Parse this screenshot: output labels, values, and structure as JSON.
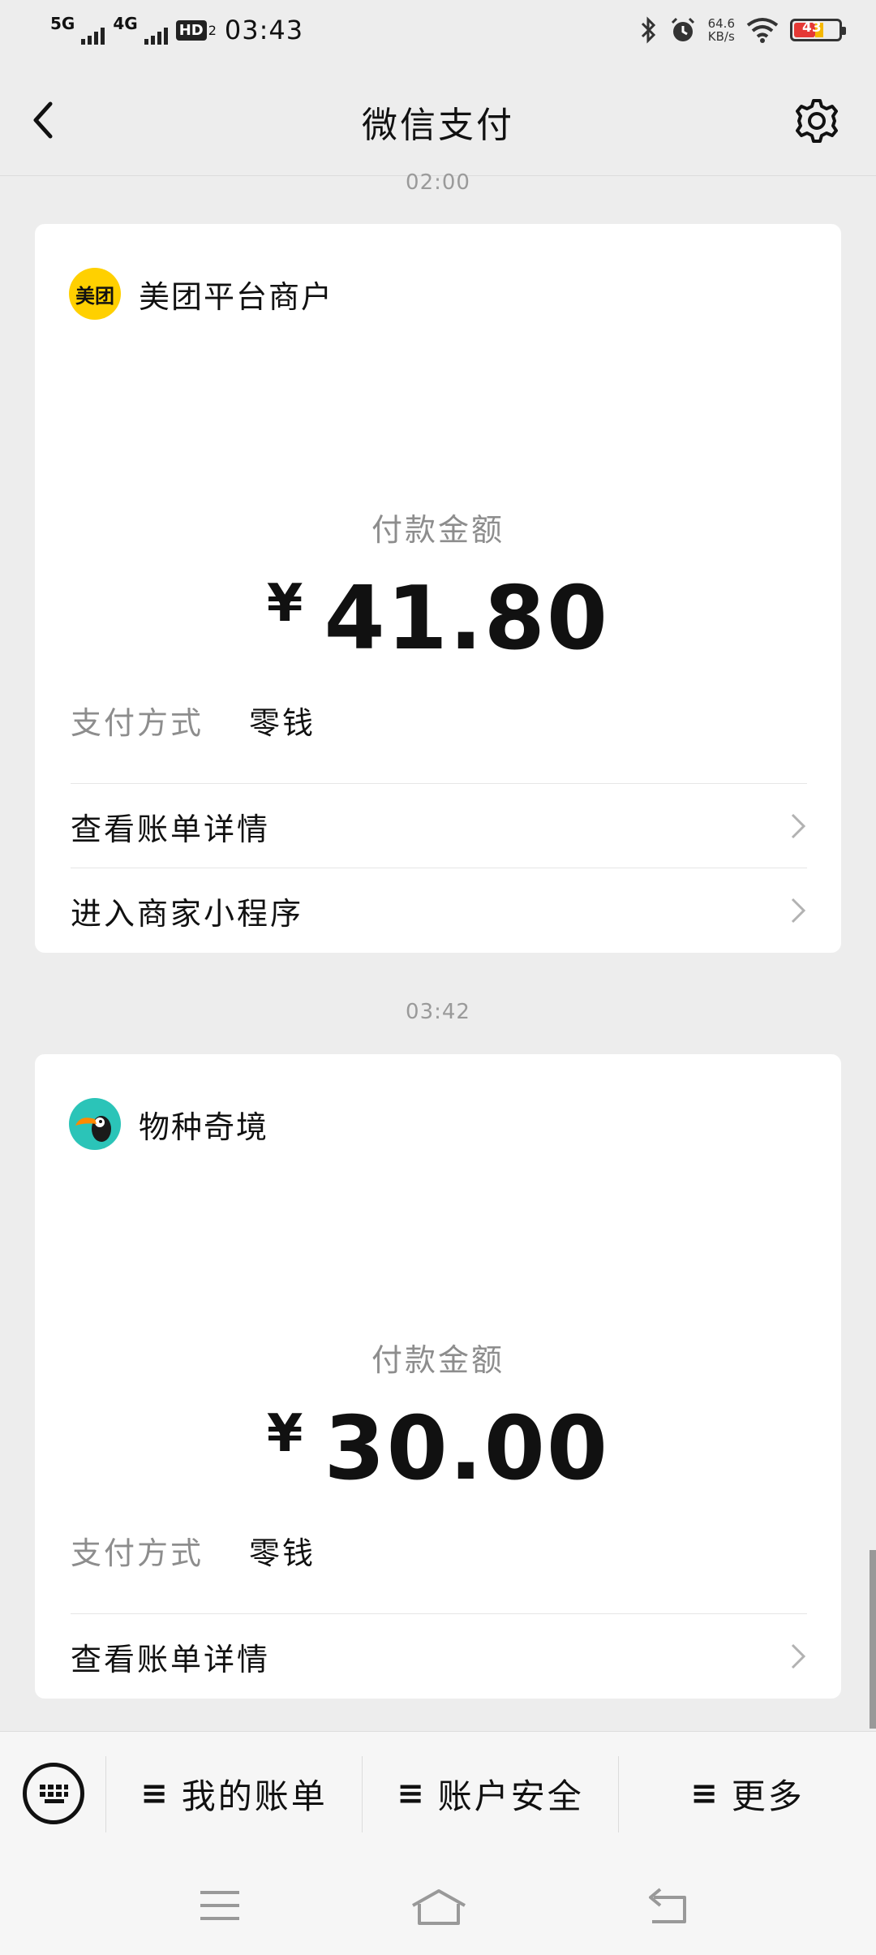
{
  "status_bar": {
    "network_1": "5G",
    "network_2": "4G",
    "hd_badge": "HD",
    "sim_number": "2",
    "time": "03:43",
    "net_speed_value": "64.6",
    "net_speed_unit": "KB/s",
    "battery_percent": "43",
    "icons": [
      "bluetooth-icon",
      "alarm-icon",
      "wifi-icon",
      "battery-icon"
    ]
  },
  "header": {
    "title": "微信支付",
    "back_icon": "chevron-left-icon",
    "settings_icon": "gear-icon"
  },
  "messages": [
    {
      "timestamp": "02:00",
      "merchant_name": "美团平台商户",
      "merchant_logo_text": "美团",
      "amount_label": "付款金额",
      "currency_symbol": "¥",
      "amount": "41.80",
      "payment_method_label": "支付方式",
      "payment_method_value": "零钱",
      "links": [
        "查看账单详情",
        "进入商家小程序"
      ]
    },
    {
      "timestamp": "03:42",
      "merchant_name": "物种奇境",
      "merchant_logo_icon": "toucan-icon",
      "amount_label": "付款金额",
      "currency_symbol": "¥",
      "amount": "30.00",
      "payment_method_label": "支付方式",
      "payment_method_value": "零钱",
      "links": [
        "查看账单详情"
      ]
    }
  ],
  "bottom_menu": {
    "keyboard_icon": "keyboard-icon",
    "items": [
      {
        "label": "我的账单",
        "icon": "menu-lines-icon"
      },
      {
        "label": "账户安全",
        "icon": "menu-lines-icon"
      },
      {
        "label": "更多",
        "icon": "menu-lines-icon"
      }
    ]
  },
  "system_nav": {
    "icons": [
      "recent-apps-icon",
      "home-icon",
      "back-icon"
    ]
  },
  "colors": {
    "background": "#ededed",
    "card": "#ffffff",
    "meituan_yellow": "#ffd000",
    "secondary_text": "#8d8d8d"
  }
}
